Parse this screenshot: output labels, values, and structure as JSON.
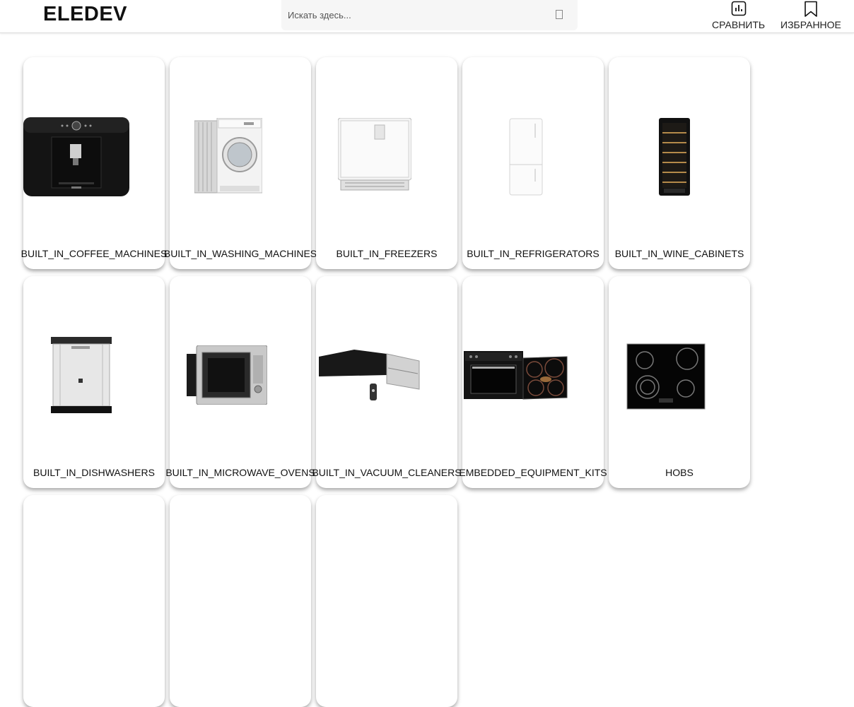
{
  "header": {
    "logo": "ELEDEV",
    "search": {
      "placeholder": "Искать здесь..."
    },
    "compare_label": "СРАВНИТЬ",
    "favorites_label": "ИЗБРАННОЕ"
  },
  "categories": [
    {
      "label": "BUILT_IN_COFFEE_MACHINES",
      "icon": "coffee-machine-image"
    },
    {
      "label": "BUILT_IN_WASHING_MACHINES",
      "icon": "washing-machine-image"
    },
    {
      "label": "BUILT_IN_FREEZERS",
      "icon": "freezer-image"
    },
    {
      "label": "BUILT_IN_REFRIGERATORS",
      "icon": "refrigerator-image"
    },
    {
      "label": "BUILT_IN_WINE_CABINETS",
      "icon": "wine-cabinet-image"
    },
    {
      "label": "BUILT_IN_DISHWASHERS",
      "icon": "dishwasher-image"
    },
    {
      "label": "BUILT_IN_MICROWAVE_OVENS",
      "icon": "microwave-oven-image"
    },
    {
      "label": "BUILT_IN_VACUUM_CLEANERS",
      "icon": "vacuum-cleaner-image"
    },
    {
      "label": "EMBEDDED_EQUIPMENT_KITS",
      "icon": "equipment-kit-image"
    },
    {
      "label": "HOBS",
      "icon": "hob-image"
    },
    {
      "label": "",
      "icon": ""
    },
    {
      "label": "",
      "icon": ""
    },
    {
      "label": "",
      "icon": ""
    }
  ]
}
